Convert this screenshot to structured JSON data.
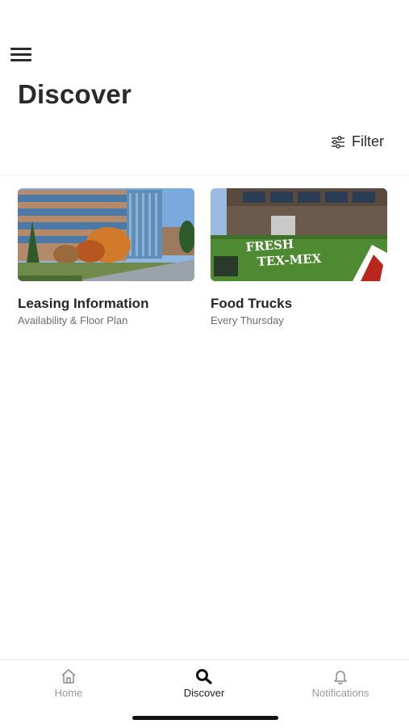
{
  "header": {
    "title": "Discover",
    "menu_icon": "hamburger-menu-icon"
  },
  "filter": {
    "label": "Filter",
    "icon": "sliders-icon"
  },
  "cards": [
    {
      "title": "Leasing Information",
      "subtitle": "Availability & Floor Plan",
      "image": "office-building-photo"
    },
    {
      "title": "Food Trucks",
      "subtitle": "Every Thursday",
      "image": "food-truck-photo",
      "truck_text": [
        "FRESH",
        "TEX-MEX"
      ]
    }
  ],
  "tabbar": {
    "items": [
      {
        "label": "Home",
        "icon": "home-icon",
        "active": false
      },
      {
        "label": "Discover",
        "icon": "search-icon",
        "active": true
      },
      {
        "label": "Notifications",
        "icon": "bell-icon",
        "active": false
      }
    ]
  },
  "colors": {
    "text": "#2a2a2a",
    "muted": "#6d6d6d",
    "inactive_tab": "#9a9a9a",
    "truck_green": "#4e8a32"
  }
}
